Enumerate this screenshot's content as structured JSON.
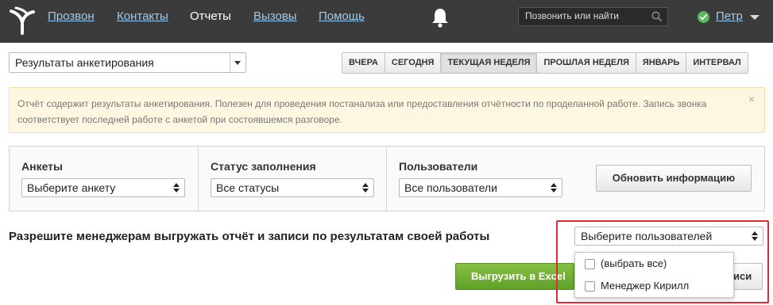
{
  "nav": {
    "items": [
      {
        "label": "Прозвон",
        "active": false
      },
      {
        "label": "Контакты",
        "active": false
      },
      {
        "label": "Отчеты",
        "active": true
      },
      {
        "label": "Вызовы",
        "active": false
      },
      {
        "label": "Помощь",
        "active": false
      }
    ]
  },
  "search": {
    "placeholder": "Позвонить или найти",
    "icon": "search-icon"
  },
  "user": {
    "name": "Петр",
    "status_color": "#5cb85c"
  },
  "report": {
    "selected": "Результаты анкетирования"
  },
  "periods": [
    {
      "label": "ВЧЕРА",
      "active": false
    },
    {
      "label": "СЕГОДНЯ",
      "active": false
    },
    {
      "label": "ТЕКУЩАЯ НЕДЕЛЯ",
      "active": true
    },
    {
      "label": "ПРОШЛАЯ НЕДЕЛЯ",
      "active": false
    },
    {
      "label": "ЯНВАРЬ",
      "active": false
    },
    {
      "label": "ИНТЕРВАЛ",
      "active": false
    }
  ],
  "notice": {
    "text": "Отчёт содержит результаты анкетирования. Полезен для проведения постанализа или предоставления отчётности по проделанной работе. Запись звонка соответствует последней работе с анкетой при состоявшемся разговоре.",
    "close": "×"
  },
  "filters": {
    "surveys": {
      "label": "Анкеты",
      "value": "Выберите анкету"
    },
    "status": {
      "label": "Статус заполнения",
      "value": "Все статусы"
    },
    "users": {
      "label": "Пользователи",
      "value": "Все пользователи"
    },
    "refresh_label": "Обновить информацию"
  },
  "permission": {
    "label": "Разрешите менеджерам выгружать отчёт и записи по результатам своей работы",
    "select_value": "Выберите пользователей",
    "options": [
      "(выбрать все)",
      "Менеджер Кирилл"
    ]
  },
  "actions": {
    "excel_label": "Выгрузить в Excel",
    "behind_label": "иси"
  },
  "colors": {
    "topbar": "#3b3b3b",
    "link": "#9ccbf0",
    "accent_green": "#6eb033",
    "highlight_red": "#e0293b",
    "notice_bg": "#fdf7e1"
  }
}
